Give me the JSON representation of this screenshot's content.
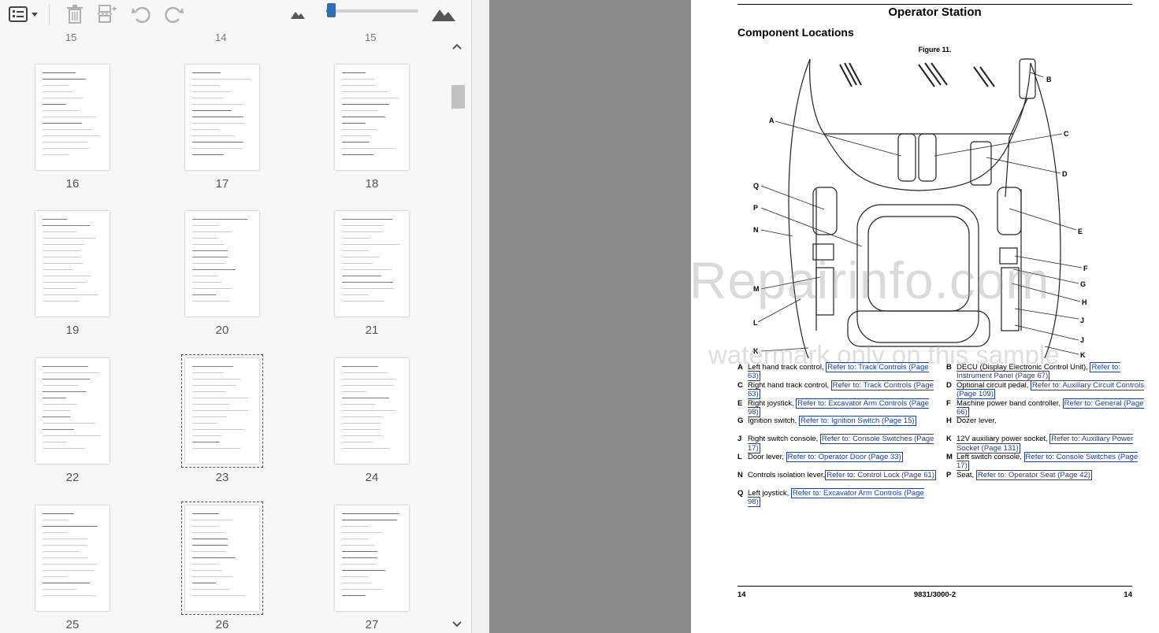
{
  "toolbar": {
    "icons": [
      "thumbnail-options-icon",
      "delete-icon",
      "extract-pages-icon",
      "rotate-left-icon",
      "rotate-right-icon",
      "zoom-out-mountain-icon",
      "zoom-in-mountain-icon"
    ],
    "zoom_fraction": 0.05
  },
  "thumbnails": {
    "cut_top_labels": [
      "15",
      "14",
      "15"
    ],
    "rows": [
      [
        "16",
        "17",
        "18"
      ],
      [
        "19",
        "20",
        "21"
      ],
      [
        "22",
        "23",
        "24"
      ],
      [
        "25",
        "26",
        "27"
      ]
    ],
    "selected": [
      "23",
      "26"
    ]
  },
  "document": {
    "title": "Operator Station",
    "subtitle": "Component Locations",
    "figure_caption": "Figure 11.",
    "callouts": [
      "A",
      "B",
      "C",
      "D",
      "E",
      "F",
      "G",
      "H",
      "J",
      "J",
      "K",
      "K",
      "L",
      "M",
      "N",
      "P",
      "Q"
    ],
    "watermark_main": "eRepairinfo.com",
    "watermark_sub": "watermark only on this sample",
    "legend_left": [
      {
        "key": "A",
        "text": "Left hand track control, ",
        "link": "Refer to: Track Controls (Page 63)"
      },
      {
        "key": "C",
        "text": "Right hand track control, ",
        "link": "Refer to: Track Controls (Page 63)"
      },
      {
        "key": "E",
        "text": "Right joystick, ",
        "link": "Refer to: Excavator Arm Controls (Page 98)"
      },
      {
        "key": "G",
        "text": "Ignition switch, ",
        "link": "Refer to: Ignition Switch (Page 15)"
      },
      {
        "key": "J",
        "text": "Right switch console, ",
        "link": "Refer to: Console Switches (Page 17)"
      },
      {
        "key": "L",
        "text": "Door lever, ",
        "link": "Refer to: Operator Door (Page 33)"
      },
      {
        "key": "N",
        "text": "Controls isolation lever,",
        "link": "Refer to: Control Lock (Page 61)"
      },
      {
        "key": "Q",
        "text": "Left joystick, ",
        "link": "Refer to: Excavator Arm Controls (Page 98)"
      }
    ],
    "legend_right": [
      {
        "key": "B",
        "text": "DECU (Display Electronic Control Unit), ",
        "link": "Refer to: Instrument Panel (Page 67)"
      },
      {
        "key": "D",
        "text": "Optional circuit pedal, ",
        "link": "Refer to: Auxiliary Circuit Controls (Page 109)"
      },
      {
        "key": "F",
        "text": "Machine power band controller, ",
        "link": "Refer to: General (Page 66)"
      },
      {
        "key": "H",
        "text": "Dozer lever,",
        "link": ""
      },
      {
        "key": "K",
        "text": "12V auxiliary power socket, ",
        "link": "Refer to: Auxiliary Power Socket (Page 131)"
      },
      {
        "key": "M",
        "text": "Left switch console, ",
        "link": "Refer to: Console Switches (Page 17)"
      },
      {
        "key": "P",
        "text": "Seat, ",
        "link": "Refer to: Operator Seat (Page 42)"
      }
    ],
    "footer_left": "14",
    "footer_center": "9831/3000-2",
    "footer_right": "14"
  },
  "colors": {
    "accent": "#2a6ebb",
    "link": "#1f3f99",
    "viewer_background": "#8b8b8b",
    "panel_background": "#f7f7f7"
  }
}
